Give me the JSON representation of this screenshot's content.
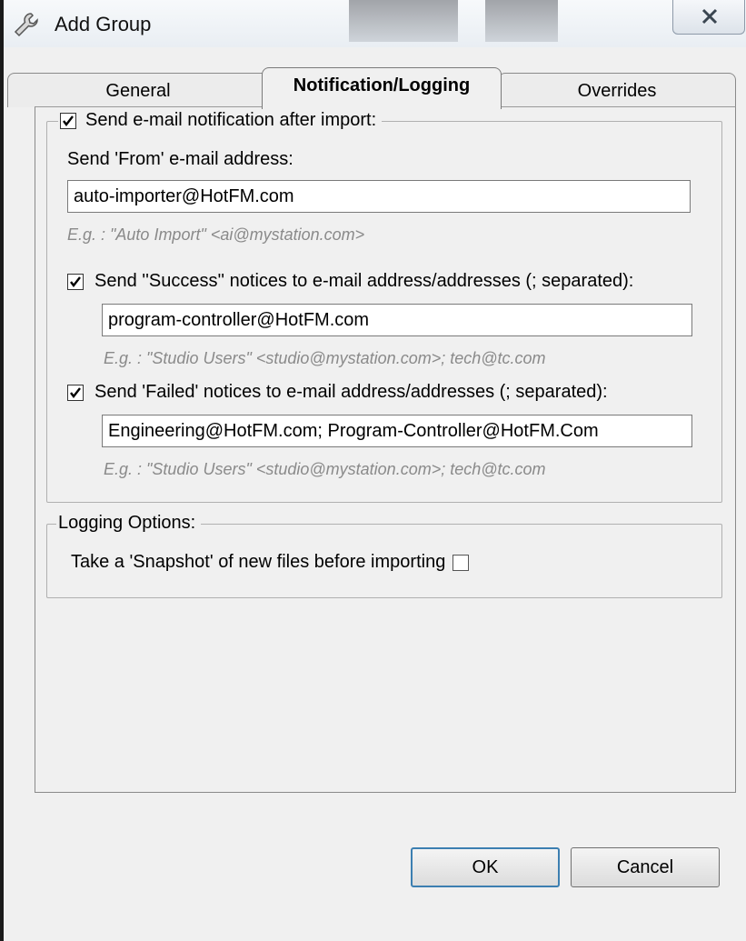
{
  "window": {
    "title": "Add Group",
    "close_icon": "close-x-icon",
    "app_icon": "wrench-icon"
  },
  "tabs": [
    {
      "label": "General"
    },
    {
      "label": "Notification/Logging"
    },
    {
      "label": "Overrides"
    }
  ],
  "active_tab": "Notification/Logging",
  "email_group": {
    "enable_label": "Send e-mail notification after import:",
    "enabled": true,
    "from_label": "Send 'From' e-mail address:",
    "from_value": "auto-importer@HotFM.com",
    "from_hint": "E.g. : \"Auto Import\" <ai@mystation.com>",
    "success_label": "Send ''Success'' notices to e-mail address/addresses (; separated):",
    "success_checked": true,
    "success_value": "program-controller@HotFM.com",
    "success_hint": "E.g. : \"Studio Users\" <studio@mystation.com>; tech@tc.com",
    "failed_label": "Send 'Failed' notices to e-mail address/addresses (; separated):",
    "failed_checked": true,
    "failed_value": "Engineering@HotFM.com; Program-Controller@HotFM.Com",
    "failed_hint": "E.g. : \"Studio Users\" <studio@mystation.com>; tech@tc.com"
  },
  "logging_group": {
    "title": "Logging Options:",
    "snapshot_label": "Take a 'Snapshot' of new files before importing",
    "snapshot_checked": false
  },
  "buttons": {
    "ok": "OK",
    "cancel": "Cancel"
  }
}
